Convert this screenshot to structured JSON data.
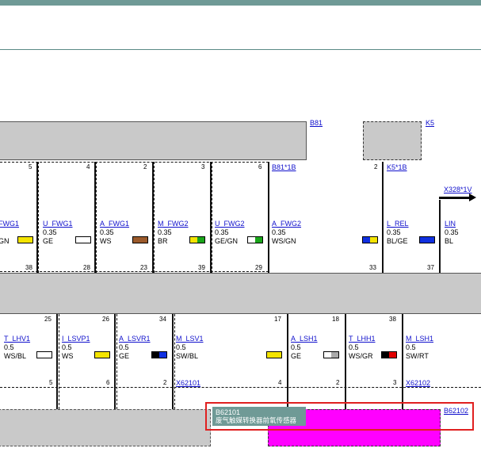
{
  "top": {
    "connectors": [
      "B81",
      "K5",
      "B81*1B",
      "K5*1B",
      "X328*1V",
      "X62101",
      "X62102",
      "B62102"
    ],
    "highlight": {
      "code": "B62101",
      "desc": "废气触媒转换器前氧传感器"
    }
  },
  "upper_wires": [
    {
      "pin_top": "5",
      "name": "FWG1",
      "size": "",
      "color": "GN",
      "pin_bot": "38",
      "swatch": [
        "#f4e400"
      ]
    },
    {
      "pin_top": "4",
      "name": "U_FWG1",
      "size": "0.35",
      "color": "GE",
      "pin_bot": "28",
      "swatch": [
        "#ffffff"
      ]
    },
    {
      "pin_top": "2",
      "name": "A_FWG1",
      "size": "0.35",
      "color": "WS",
      "pin_bot": "23",
      "swatch": [
        "#9b5a2b"
      ]
    },
    {
      "pin_top": "3",
      "name": "M_FWG2",
      "size": "0.35",
      "color": "BR",
      "pin_bot": "39",
      "swatch": [
        "#f4e400",
        "#1aa51a"
      ]
    },
    {
      "pin_top": "6",
      "name": "U_FWG2",
      "size": "0.35",
      "color": "GE/GN",
      "pin_bot": "29",
      "swatch": [
        "#ffffff",
        "#1aa51a"
      ]
    },
    {
      "pin_top": "",
      "name": "A_FWG2",
      "size": "0.35",
      "color": "WS/GN",
      "pin_bot": "",
      "swatch": []
    },
    {
      "pin_top": "2",
      "name": "L_REL",
      "size": "0.35",
      "color": "BL/GE",
      "pin_bot": "33",
      "swatch": [
        "#1030e0",
        "#f4e400"
      ]
    },
    {
      "pin_top": "",
      "name": "LIN",
      "size": "0.35",
      "color": "BL",
      "pin_bot": "37",
      "swatch": [
        "#1030e0"
      ]
    }
  ],
  "lower_wires": [
    {
      "pin_top": "25",
      "name": "T_LHV1",
      "size": "0.5",
      "color": "WS/BL",
      "pin_bot": "5",
      "swatch": [
        "#ffffff"
      ]
    },
    {
      "pin_top": "26",
      "name": "I_LSVP1",
      "size": "0.5",
      "color": "WS",
      "pin_bot": "6",
      "swatch": [
        "#f4e400"
      ]
    },
    {
      "pin_top": "34",
      "name": "A_LSVR1",
      "size": "0.5",
      "color": "GE",
      "pin_bot": "2",
      "swatch": [
        "#000000",
        "#1030e0"
      ]
    },
    {
      "pin_top": "",
      "name": "M_LSV1",
      "size": "0.5",
      "color": "SW/BL",
      "pin_bot": "",
      "swatch": []
    },
    {
      "pin_top": "17",
      "name": "",
      "size": "",
      "color": "",
      "pin_bot": "4",
      "swatch": [
        "#f4e400"
      ]
    },
    {
      "pin_top": "18",
      "name": "A_LSH1",
      "size": "0.5",
      "color": "GE",
      "pin_bot": "2",
      "swatch": [
        "#ffffff",
        "#aaaaaa"
      ]
    },
    {
      "pin_top": "38",
      "name": "T_LHH1",
      "size": "0.5",
      "color": "WS/GR",
      "pin_bot": "3",
      "swatch": [
        "#000000",
        "#e00000"
      ]
    },
    {
      "pin_top": "",
      "name": "M_LSH1",
      "size": "0.5",
      "color": "SW/RT",
      "pin_bot": "",
      "swatch": []
    }
  ],
  "colors": {
    "accent": "#6f9a96",
    "magenta": "#ff00ff",
    "highlight_border": "#e02020"
  }
}
